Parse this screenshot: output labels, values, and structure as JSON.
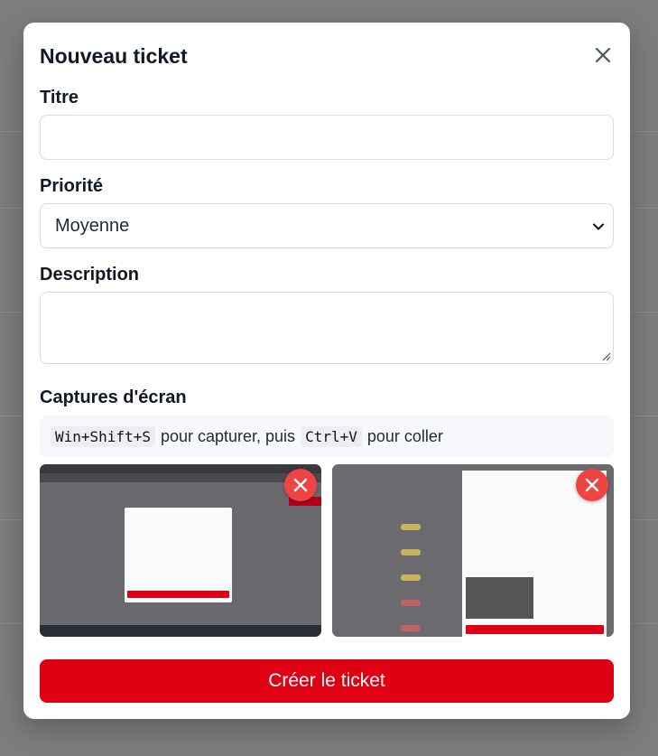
{
  "modal": {
    "title": "Nouveau ticket",
    "close_icon": "close-icon"
  },
  "form": {
    "title_label": "Titre",
    "title_value": "",
    "priority_label": "Priorité",
    "priority_value": "Moyenne",
    "description_label": "Description",
    "description_value": "",
    "screenshots_label": "Captures d'écran",
    "hint": {
      "key1": "Win+Shift+S",
      "text1": "pour capturer, puis",
      "key2": "Ctrl+V",
      "text2": "pour coller"
    },
    "screenshots": [
      {
        "remove_icon": "close-icon"
      },
      {
        "remove_icon": "close-icon"
      }
    ],
    "submit_label": "Créer le ticket"
  },
  "colors": {
    "primary": "#e00014",
    "remove": "#ef4444"
  }
}
